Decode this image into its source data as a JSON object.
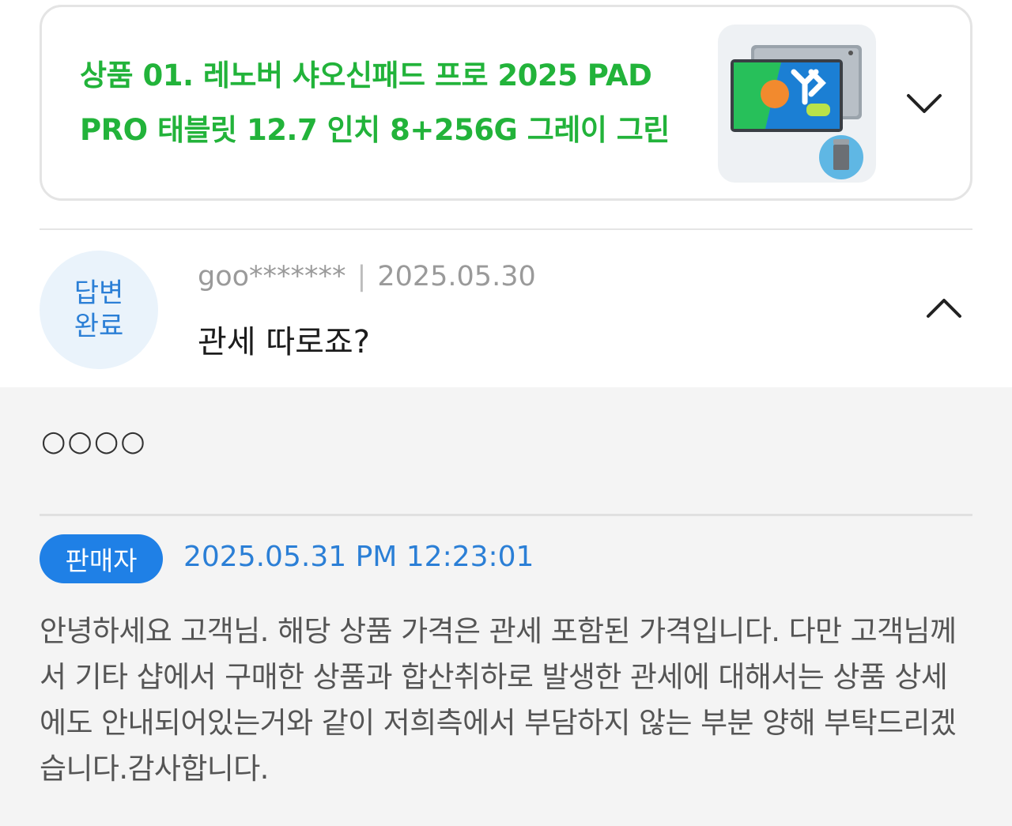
{
  "product": {
    "title": "상품 01. 레노버 샤오신패드 프로 2025 PAD PRO 태블릿 12.7 인치 8+256G 그레이 그린",
    "thumbnail_icon": "tablet-product-image",
    "expand_icon": "chevron-down-icon"
  },
  "question": {
    "status_badge": "답변\n완료",
    "author": "goo*******",
    "separator": "|",
    "date": "2025.05.30",
    "text": "관세 따로죠?",
    "collapse_icon": "chevron-up-icon"
  },
  "answer": {
    "masked_text": "○○○○",
    "seller_label": "판매자",
    "date": "2025.05.31 PM 12:23:01",
    "body": "안녕하세요 고객님. 해당 상품 가격은 관세 포함된 가격입니다. 다만 고객님께서 기타 샵에서 구매한 상품과 합산취하로 발생한 관세에 대해서는 상품 상세에도 안내되어있는거와 같이 저희측에서 부담하지 않는 부분 양해 부탁드리겠습니다.감사합니다."
  },
  "colors": {
    "product_title": "#22b33a",
    "accent_blue": "#1f80e6",
    "status_badge_bg": "#eaf3fb",
    "answer_bg": "#f4f4f4"
  }
}
